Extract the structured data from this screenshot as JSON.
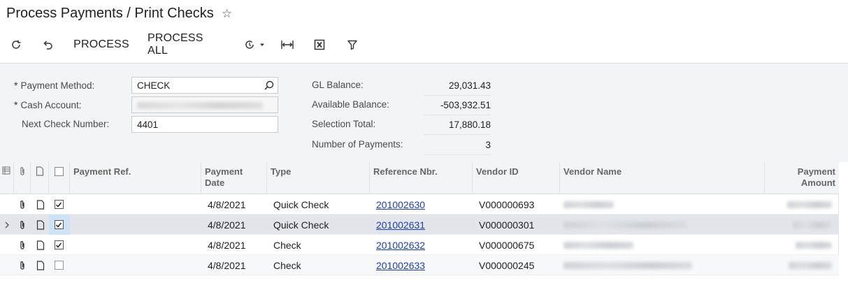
{
  "title": "Process Payments / Print Checks",
  "toolbar": {
    "process": "PROCESS",
    "process_all": "PROCESS ALL"
  },
  "form": {
    "payment_method_label": "Payment Method:",
    "payment_method_value": "CHECK",
    "cash_account_label": "Cash Account:",
    "next_check_label": "Next Check Number:",
    "next_check_value": "4401",
    "gl_balance_label": "GL Balance:",
    "gl_balance_value": "29,031.43",
    "available_balance_label": "Available Balance:",
    "available_balance_value": "-503,932.51",
    "selection_total_label": "Selection Total:",
    "selection_total_value": "17,880.18",
    "number_of_payments_label": "Number of Payments:",
    "number_of_payments_value": "3",
    "required_mark": "*"
  },
  "grid": {
    "headers": {
      "payment_ref": "Payment Ref.",
      "payment_date_1": "Payment",
      "payment_date_2": "Date",
      "type": "Type",
      "reference_nbr": "Reference Nbr.",
      "vendor_id": "Vendor ID",
      "vendor_name": "Vendor Name",
      "payment_amount_1": "Payment",
      "payment_amount_2": "Amount"
    },
    "rows": [
      {
        "date": "4/8/2021",
        "type": "Quick Check",
        "ref": "201002630",
        "vendor": "V000000693",
        "checked": true
      },
      {
        "date": "4/8/2021",
        "type": "Quick Check",
        "ref": "201002631",
        "vendor": "V000000301",
        "checked": true
      },
      {
        "date": "4/8/2021",
        "type": "Check",
        "ref": "201002632",
        "vendor": "V000000675",
        "checked": true
      },
      {
        "date": "4/8/2021",
        "type": "Check",
        "ref": "201002633",
        "vendor": "V000000245",
        "checked": false
      }
    ]
  }
}
